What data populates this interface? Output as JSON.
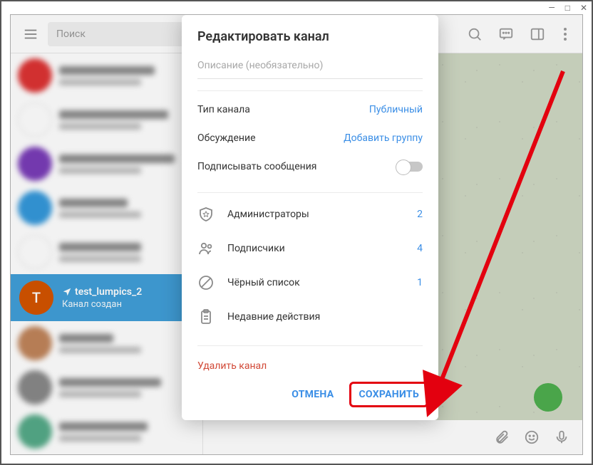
{
  "window": {
    "minimize": "—",
    "maximize": "□",
    "close": "✕"
  },
  "topbar": {
    "search_placeholder": "Поиск"
  },
  "selected_chat": {
    "avatar_letter": "T",
    "title": "test_lumpics_2",
    "subtitle": "Канал создан"
  },
  "modal": {
    "title": "Редактировать канал",
    "description_placeholder": "Описание (необязательно)",
    "channel_type_label": "Тип канала",
    "channel_type_value": "Публичный",
    "discussion_label": "Обсуждение",
    "discussion_value": "Добавить группу",
    "sign_messages_label": "Подписывать сообщения",
    "admins_label": "Администраторы",
    "admins_count": "2",
    "subs_label": "Подписчики",
    "subs_count": "4",
    "blacklist_label": "Чёрный список",
    "blacklist_count": "1",
    "recent_label": "Недавние действия",
    "delete_label": "Удалить канал",
    "cancel_btn": "ОТМЕНА",
    "save_btn": "СОХРАНИТЬ"
  }
}
